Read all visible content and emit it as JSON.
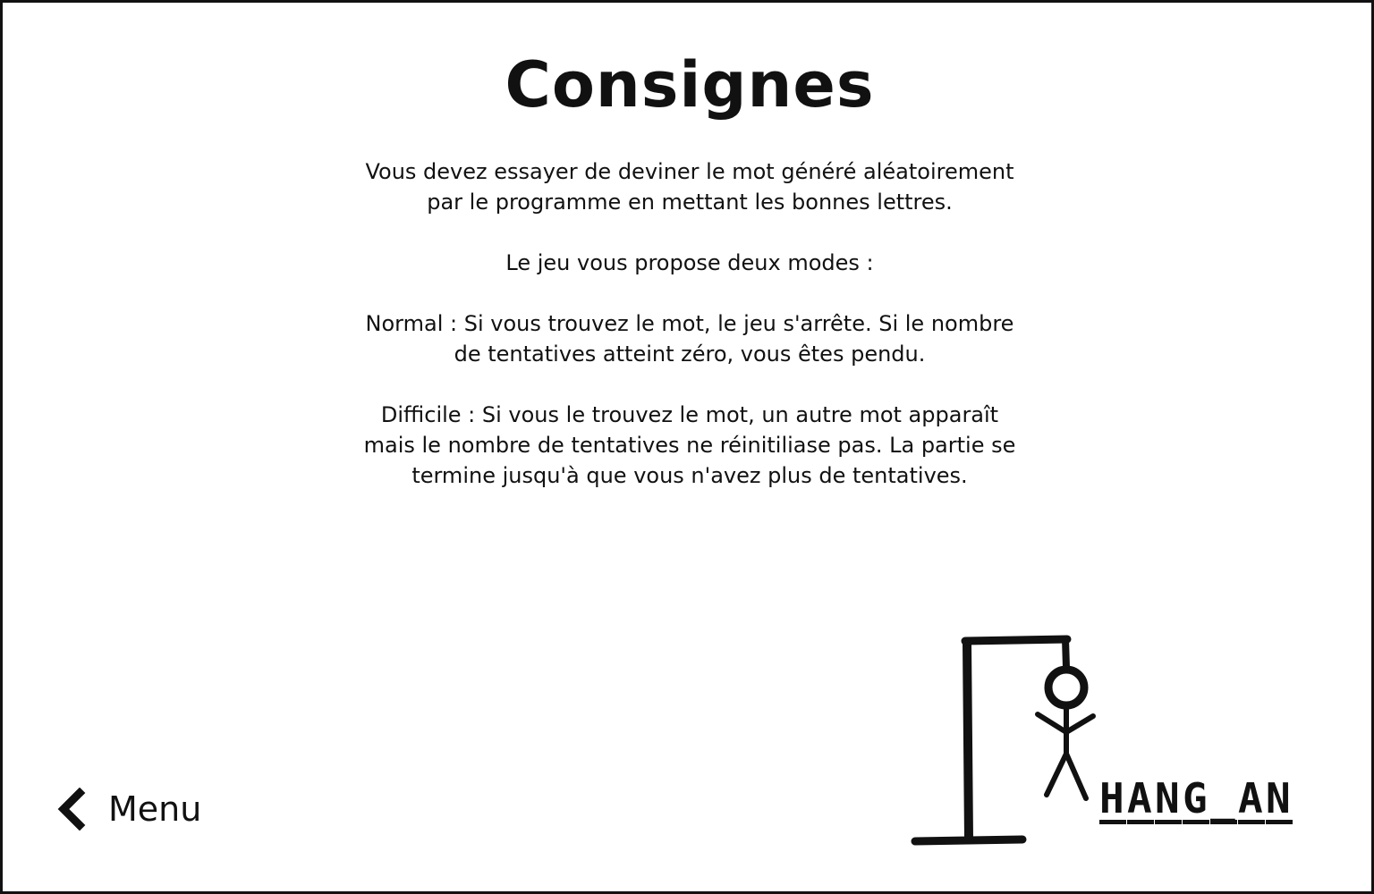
{
  "page": {
    "title": "Consignes",
    "paragraphs": [
      "Vous devez essayer de deviner le mot généré aléatoirement par le programme en mettant les bonnes lettres.",
      "Le jeu vous propose deux modes :",
      "Normal : Si vous trouvez le mot, le jeu s'arrête. Si le nombre de tentatives atteint zéro, vous êtes pendu.",
      "Difficile : Si vous le trouvez le mot, un autre mot apparaît mais le nombre de tentatives ne réinitiliase pas. La partie se termine jusqu'à que vous n'avez plus de tentatives."
    ]
  },
  "nav": {
    "back_label": "Menu",
    "back_icon": "chevron-left-icon"
  },
  "logo": {
    "icon": "gallows-stickman-icon",
    "letters": [
      "H",
      "A",
      "N",
      "G",
      "_",
      "A",
      "N"
    ]
  },
  "colors": {
    "ink": "#111111",
    "background": "#ffffff"
  }
}
